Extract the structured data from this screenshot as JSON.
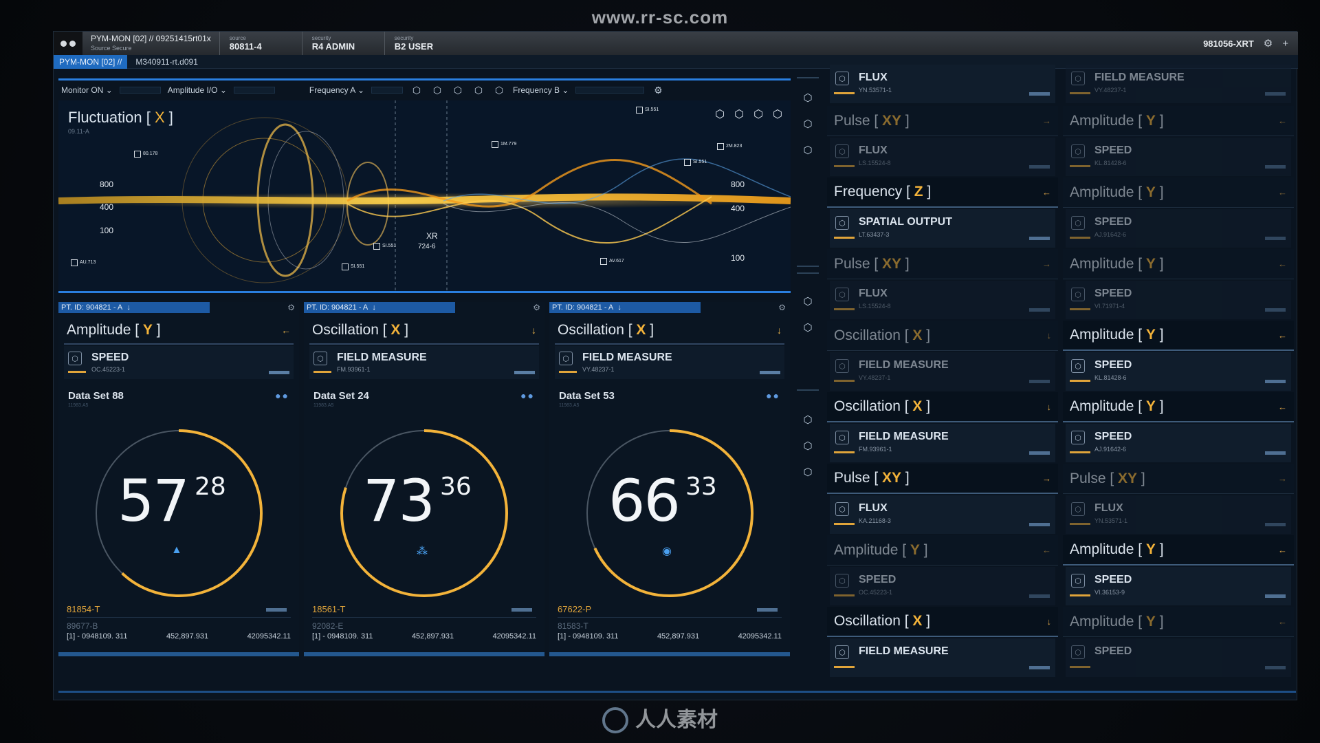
{
  "watermark": "www.rr-sc.com",
  "brand": "人人素材",
  "topbar": {
    "title": "PYM-MON [02] // 09251415rt01x",
    "subtitle": "Source Secure",
    "segments": [
      {
        "label": "source",
        "value": "80811-4"
      },
      {
        "label": "security",
        "value": "R4 ADMIN"
      },
      {
        "label": "security",
        "value": "B2 USER"
      }
    ],
    "right_value": "981056-XRT"
  },
  "subbar": {
    "chip": "PYM-MON [02] //",
    "path": "M340911-rt.d091"
  },
  "controls": {
    "monitor": "Monitor  ON",
    "amplitude": "Amplitude I/O",
    "freq_a": "Frequency A",
    "freq_b": "Frequency B"
  },
  "hero": {
    "title_prefix": "Fluctuation [ ",
    "title_axis": "X",
    "title_suffix": " ]",
    "subtitle": "09.11-A",
    "labels": [
      "800",
      "400",
      "100",
      "800",
      "400",
      "100",
      "XR",
      "724-6"
    ],
    "tags": [
      "80.178",
      "AU.713",
      "SI.551",
      "SI.551",
      "1M.779",
      "SI.551",
      "2M.823",
      "SI.551",
      "AV.617"
    ]
  },
  "panes": [
    {
      "pt": "PT. ID: 904821 - A",
      "head": "Amplitude [ ",
      "axis": "Y",
      "arrow": "←",
      "meas": "SPEED",
      "meas_sub": "OC.45223-1",
      "dataset": "Data Set 88",
      "dataset_sub": "11983.A5",
      "big": "57",
      "small": "28",
      "progress": 0.62,
      "f1": "81854-T",
      "f2": "89677-B",
      "row": [
        "[1] - 0948109. 311",
        "452,897.931",
        "42095342.11"
      ]
    },
    {
      "pt": "PT. ID: 904821 - A",
      "head": "Oscillation [ ",
      "axis": "X",
      "arrow": "↓",
      "meas": "FIELD MEASURE",
      "meas_sub": "FM.93961-1",
      "dataset": "Data Set 24",
      "dataset_sub": "11983.A5",
      "big": "73",
      "small": "36",
      "progress": 0.8,
      "f1": "18561-T",
      "f2": "92082-E",
      "row": [
        "[1] - 0948109. 311",
        "452,897.931",
        "42095342.11"
      ]
    },
    {
      "pt": "PT. ID: 904821 - A",
      "head": "Oscillation [ ",
      "axis": "X",
      "arrow": "↓",
      "meas": "FIELD MEASURE",
      "meas_sub": "VY.48237-1",
      "dataset": "Data Set 53",
      "dataset_sub": "11983.A5",
      "big": "66",
      "small": "33",
      "progress": 0.68,
      "f1": "67622-P",
      "f2": "81583-T",
      "row": [
        "[1] - 0948109. 311",
        "452,897.931",
        "42095342.11"
      ]
    }
  ],
  "col_mid": [
    {
      "head": "",
      "axis": "",
      "arrow": "",
      "meas": "FLUX",
      "sub": "YN.53571-1",
      "dim": false
    },
    {
      "head": "Pulse [ ",
      "axis": "XY",
      "arrow": "→",
      "meas": "FLUX",
      "sub": "LS.15524-8",
      "dim": true
    },
    {
      "head": "Frequency [ ",
      "axis": "Z",
      "arrow": "←",
      "meas": "SPATIAL OUTPUT",
      "sub": "LT.63437-3",
      "dim": false
    },
    {
      "head": "Pulse [ ",
      "axis": "XY",
      "arrow": "→",
      "meas": "FLUX",
      "sub": "LS.15524-8",
      "dim": true
    },
    {
      "head": "Oscillation [ ",
      "axis": "X",
      "arrow": "↓",
      "meas": "FIELD MEASURE",
      "sub": "VY.48237-1",
      "dim": true
    },
    {
      "head": "Oscillation [ ",
      "axis": "X",
      "arrow": "↓",
      "meas": "FIELD MEASURE",
      "sub": "FM.93961-1",
      "dim": false
    },
    {
      "head": "Pulse [ ",
      "axis": "XY",
      "arrow": "→",
      "meas": "FLUX",
      "sub": "KA.21168-3",
      "dim": false
    },
    {
      "head": "Amplitude [ ",
      "axis": "Y",
      "arrow": "←",
      "meas": "SPEED",
      "sub": "OC.45223-1",
      "dim": true
    },
    {
      "head": "Oscillation [ ",
      "axis": "X",
      "arrow": "↓",
      "meas": "FIELD MEASURE",
      "sub": "",
      "dim": false
    }
  ],
  "col_right": [
    {
      "head": "",
      "axis": "",
      "arrow": "",
      "meas": "FIELD MEASURE",
      "sub": "VY.48237-1",
      "dim": true
    },
    {
      "head": "Amplitude [ ",
      "axis": "Y",
      "arrow": "←",
      "meas": "SPEED",
      "sub": "KL.81428-6",
      "dim": true
    },
    {
      "head": "Amplitude [ ",
      "axis": "Y",
      "arrow": "←",
      "meas": "SPEED",
      "sub": "AJ.91642-6",
      "dim": true
    },
    {
      "head": "Amplitude [ ",
      "axis": "Y",
      "arrow": "←",
      "meas": "SPEED",
      "sub": "VI.71971-4",
      "dim": true
    },
    {
      "head": "Amplitude [ ",
      "axis": "Y",
      "arrow": "←",
      "meas": "SPEED",
      "sub": "KL.81428-6",
      "dim": false
    },
    {
      "head": "Amplitude [ ",
      "axis": "Y",
      "arrow": "←",
      "meas": "SPEED",
      "sub": "AJ.91642-6",
      "dim": false
    },
    {
      "head": "Pulse [ ",
      "axis": "XY",
      "arrow": "→",
      "meas": "FLUX",
      "sub": "YN.53571-1",
      "dim": true
    },
    {
      "head": "Amplitude [ ",
      "axis": "Y",
      "arrow": "←",
      "meas": "SPEED",
      "sub": "VI.36153-9",
      "dim": false
    },
    {
      "head": "Amplitude [ ",
      "axis": "Y",
      "arrow": "←",
      "meas": "SPEED",
      "sub": "",
      "dim": true
    }
  ],
  "colors": {
    "accent": "#f3b33a",
    "blue": "#2a7fe0"
  }
}
